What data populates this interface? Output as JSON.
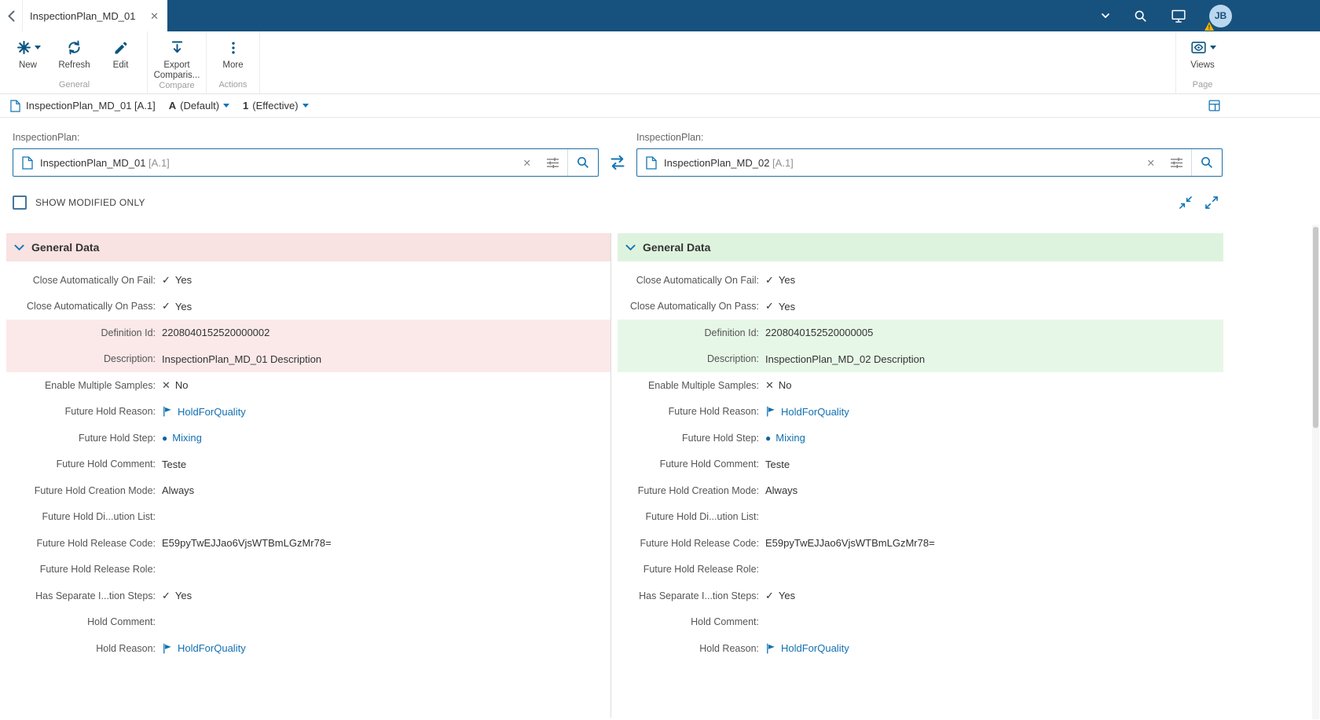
{
  "colors": {
    "topbar": "#17517e",
    "accent": "#1375b5",
    "toolbar_icon": "#0a5480",
    "link": "#1270b0",
    "removed_header": "#f8e2e2",
    "removed_row": "#fbe9e9",
    "added_header": "#def3de",
    "added_row": "#e7f7e7",
    "warning": "#f2b600"
  },
  "icons": {
    "back": "chevron-left",
    "tab_close": "✕",
    "search": "magnifier",
    "feedback": "monitor",
    "dropdown": "chevron-down",
    "new": "✳",
    "refresh": "⟳",
    "edit": "✎",
    "export": "⭳",
    "more": "⋮",
    "views": "eye",
    "document": "page",
    "layout": "table-panel",
    "swap": "⇄",
    "clear": "✕",
    "advanced_filter": "tune-sliders",
    "collapse_all": "arrows-in",
    "expand_all": "arrows-out",
    "check": "✓",
    "cross": "✕",
    "flag": "⚑",
    "step": "●",
    "warning": "⚠"
  },
  "topbar": {
    "tab_title": "InspectionPlan_MD_01",
    "avatar_initials": "JB"
  },
  "toolbar": {
    "new_label": "New",
    "refresh_label": "Refresh",
    "edit_label": "Edit",
    "export_label": "Export Comparis...",
    "more_label": "More",
    "views_label": "Views",
    "group_general": "General",
    "group_compare": "Compare",
    "group_actions": "Actions",
    "group_page": "Page"
  },
  "breadcrumb": {
    "entity_title": "InspectionPlan_MD_01 [A.1]",
    "version_value": "A",
    "version_label": "(Default)",
    "revision_value": "1",
    "revision_label": "(Effective)"
  },
  "selectors": {
    "left_label": "InspectionPlan:",
    "left_value": "InspectionPlan_MD_01",
    "left_version": "[A.1]",
    "right_label": "InspectionPlan:",
    "right_value": "InspectionPlan_MD_02",
    "right_version": "[A.1]"
  },
  "filters": {
    "show_modified_label": "SHOW MODIFIED ONLY",
    "checked": false
  },
  "panels": [
    {
      "side": "left",
      "section_title": "General Data",
      "rows": [
        {
          "label": "Close Automatically On Fail:",
          "value": "Yes",
          "icon": "check",
          "link": false,
          "diff": false
        },
        {
          "label": "Close Automatically On Pass:",
          "value": "Yes",
          "icon": "check",
          "link": false,
          "diff": false
        },
        {
          "label": "Definition Id:",
          "value": "2208040152520000002",
          "icon": null,
          "link": false,
          "diff": true
        },
        {
          "label": "Description:",
          "value": "InspectionPlan_MD_01 Description",
          "icon": null,
          "link": false,
          "diff": true
        },
        {
          "label": "Enable Multiple Samples:",
          "value": "No",
          "icon": "cross",
          "link": false,
          "diff": false
        },
        {
          "label": "Future Hold Reason:",
          "value": "HoldForQuality",
          "icon": "flag",
          "link": true,
          "diff": false
        },
        {
          "label": "Future Hold Step:",
          "value": "Mixing",
          "icon": "circle",
          "link": true,
          "diff": false
        },
        {
          "label": "Future Hold Comment:",
          "value": "Teste",
          "icon": null,
          "link": false,
          "diff": false
        },
        {
          "label": "Future Hold Creation Mode:",
          "value": "Always",
          "icon": null,
          "link": false,
          "diff": false
        },
        {
          "label": "Future Hold Di...ution List:",
          "value": "",
          "icon": null,
          "link": false,
          "diff": false
        },
        {
          "label": "Future Hold Release Code:",
          "value": "E59pyTwEJJao6VjsWTBmLGzMr78=",
          "icon": null,
          "link": false,
          "diff": false
        },
        {
          "label": "Future Hold Release Role:",
          "value": "",
          "icon": null,
          "link": false,
          "diff": false
        },
        {
          "label": "Has Separate I...tion Steps:",
          "value": "Yes",
          "icon": "check",
          "link": false,
          "diff": false
        },
        {
          "label": "Hold Comment:",
          "value": "",
          "icon": null,
          "link": false,
          "diff": false
        },
        {
          "label": "Hold Reason:",
          "value": "HoldForQuality",
          "icon": "flag",
          "link": true,
          "diff": false
        }
      ]
    },
    {
      "side": "right",
      "section_title": "General Data",
      "rows": [
        {
          "label": "Close Automatically On Fail:",
          "value": "Yes",
          "icon": "check",
          "link": false,
          "diff": false
        },
        {
          "label": "Close Automatically On Pass:",
          "value": "Yes",
          "icon": "check",
          "link": false,
          "diff": false
        },
        {
          "label": "Definition Id:",
          "value": "2208040152520000005",
          "icon": null,
          "link": false,
          "diff": true
        },
        {
          "label": "Description:",
          "value": "InspectionPlan_MD_02 Description",
          "icon": null,
          "link": false,
          "diff": true
        },
        {
          "label": "Enable Multiple Samples:",
          "value": "No",
          "icon": "cross",
          "link": false,
          "diff": false
        },
        {
          "label": "Future Hold Reason:",
          "value": "HoldForQuality",
          "icon": "flag",
          "link": true,
          "diff": false
        },
        {
          "label": "Future Hold Step:",
          "value": "Mixing",
          "icon": "circle",
          "link": true,
          "diff": false
        },
        {
          "label": "Future Hold Comment:",
          "value": "Teste",
          "icon": null,
          "link": false,
          "diff": false
        },
        {
          "label": "Future Hold Creation Mode:",
          "value": "Always",
          "icon": null,
          "link": false,
          "diff": false
        },
        {
          "label": "Future Hold Di...ution List:",
          "value": "",
          "icon": null,
          "link": false,
          "diff": false
        },
        {
          "label": "Future Hold Release Code:",
          "value": "E59pyTwEJJao6VjsWTBmLGzMr78=",
          "icon": null,
          "link": false,
          "diff": false
        },
        {
          "label": "Future Hold Release Role:",
          "value": "",
          "icon": null,
          "link": false,
          "diff": false
        },
        {
          "label": "Has Separate I...tion Steps:",
          "value": "Yes",
          "icon": "check",
          "link": false,
          "diff": false
        },
        {
          "label": "Hold Comment:",
          "value": "",
          "icon": null,
          "link": false,
          "diff": false
        },
        {
          "label": "Hold Reason:",
          "value": "HoldForQuality",
          "icon": "flag",
          "link": true,
          "diff": false
        }
      ]
    }
  ]
}
